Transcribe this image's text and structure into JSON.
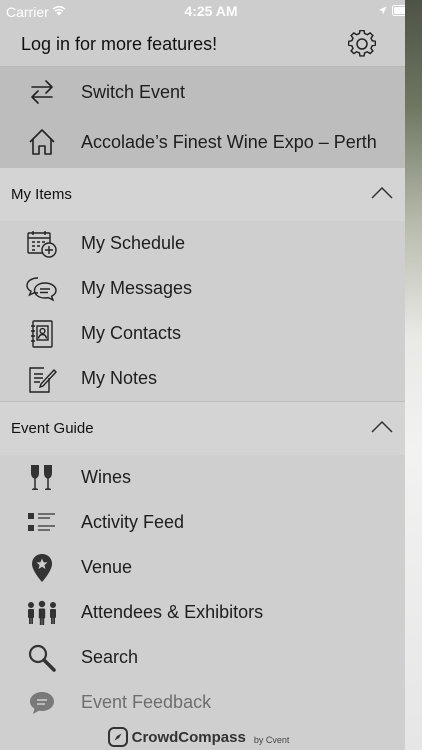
{
  "status_bar": {
    "carrier": "Carrier",
    "time": "4:25 AM"
  },
  "header": {
    "login_text": "Log in for more features!",
    "settings_icon": "gear-icon"
  },
  "top_items": [
    {
      "label": "Switch Event",
      "icon": "switch-arrows-icon"
    },
    {
      "label": "Accolade’s Finest Wine Expo – Perth",
      "icon": "home-icon"
    }
  ],
  "sections": [
    {
      "title": "My Items",
      "items": [
        {
          "label": "My Schedule",
          "icon": "calendar-add-icon"
        },
        {
          "label": "My Messages",
          "icon": "chat-bubbles-icon"
        },
        {
          "label": "My Contacts",
          "icon": "contact-book-icon"
        },
        {
          "label": "My Notes",
          "icon": "notepad-pen-icon"
        }
      ]
    },
    {
      "title": "Event Guide",
      "items": [
        {
          "label": "Wines",
          "icon": "wine-glasses-icon"
        },
        {
          "label": "Activity Feed",
          "icon": "list-icon"
        },
        {
          "label": "Venue",
          "icon": "map-pin-star-icon"
        },
        {
          "label": "Attendees & Exhibitors",
          "icon": "people-group-icon"
        },
        {
          "label": "Search",
          "icon": "magnifier-icon"
        },
        {
          "label": "Event Feedback",
          "icon": "feedback-bubble-icon"
        }
      ]
    }
  ],
  "footer": {
    "brand_name": "CrowdCompass",
    "brand_suffix": "by Cvent"
  }
}
